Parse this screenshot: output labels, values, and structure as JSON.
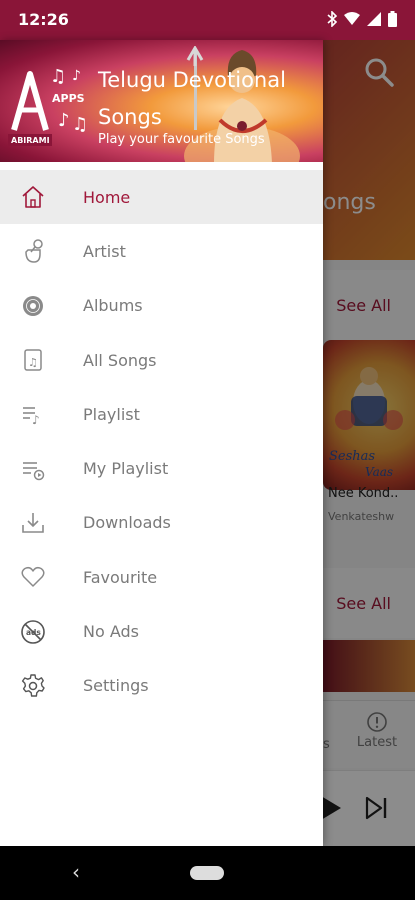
{
  "status_bar": {
    "time": "12:26"
  },
  "background": {
    "header_peek": "ongs",
    "see_all_1": "See All",
    "see_all_2": "See All",
    "song_card": {
      "title": "Nee Kond..",
      "artist": "Venkateshw",
      "art_text_1": "Seshas",
      "art_text_2": "Vaas"
    },
    "tabs": {
      "peek": "s",
      "latest": "Latest"
    }
  },
  "drawer": {
    "logo": {
      "letter": "A",
      "word": "APPS",
      "brand": "ABIRAMI"
    },
    "title": "Telugu Devotional Songs",
    "subtitle": "Play your favourite Songs",
    "menu": [
      {
        "label": "Home",
        "icon": "home-icon",
        "active": true
      },
      {
        "label": "Artist",
        "icon": "artist-icon"
      },
      {
        "label": "Albums",
        "icon": "album-icon"
      },
      {
        "label": "All Songs",
        "icon": "music-file-icon"
      },
      {
        "label": "Playlist",
        "icon": "playlist-icon"
      },
      {
        "label": "My Playlist",
        "icon": "playlist-add-icon"
      },
      {
        "label": "Downloads",
        "icon": "download-icon"
      },
      {
        "label": "Favourite",
        "icon": "heart-icon"
      },
      {
        "label": "No Ads",
        "icon": "no-ads-icon",
        "icon_text": "ads"
      },
      {
        "label": "Settings",
        "icon": "settings-icon"
      }
    ]
  },
  "colors": {
    "accent": "#a0183a",
    "status_bar": "#8a1538",
    "label": "#7a7a7a"
  }
}
